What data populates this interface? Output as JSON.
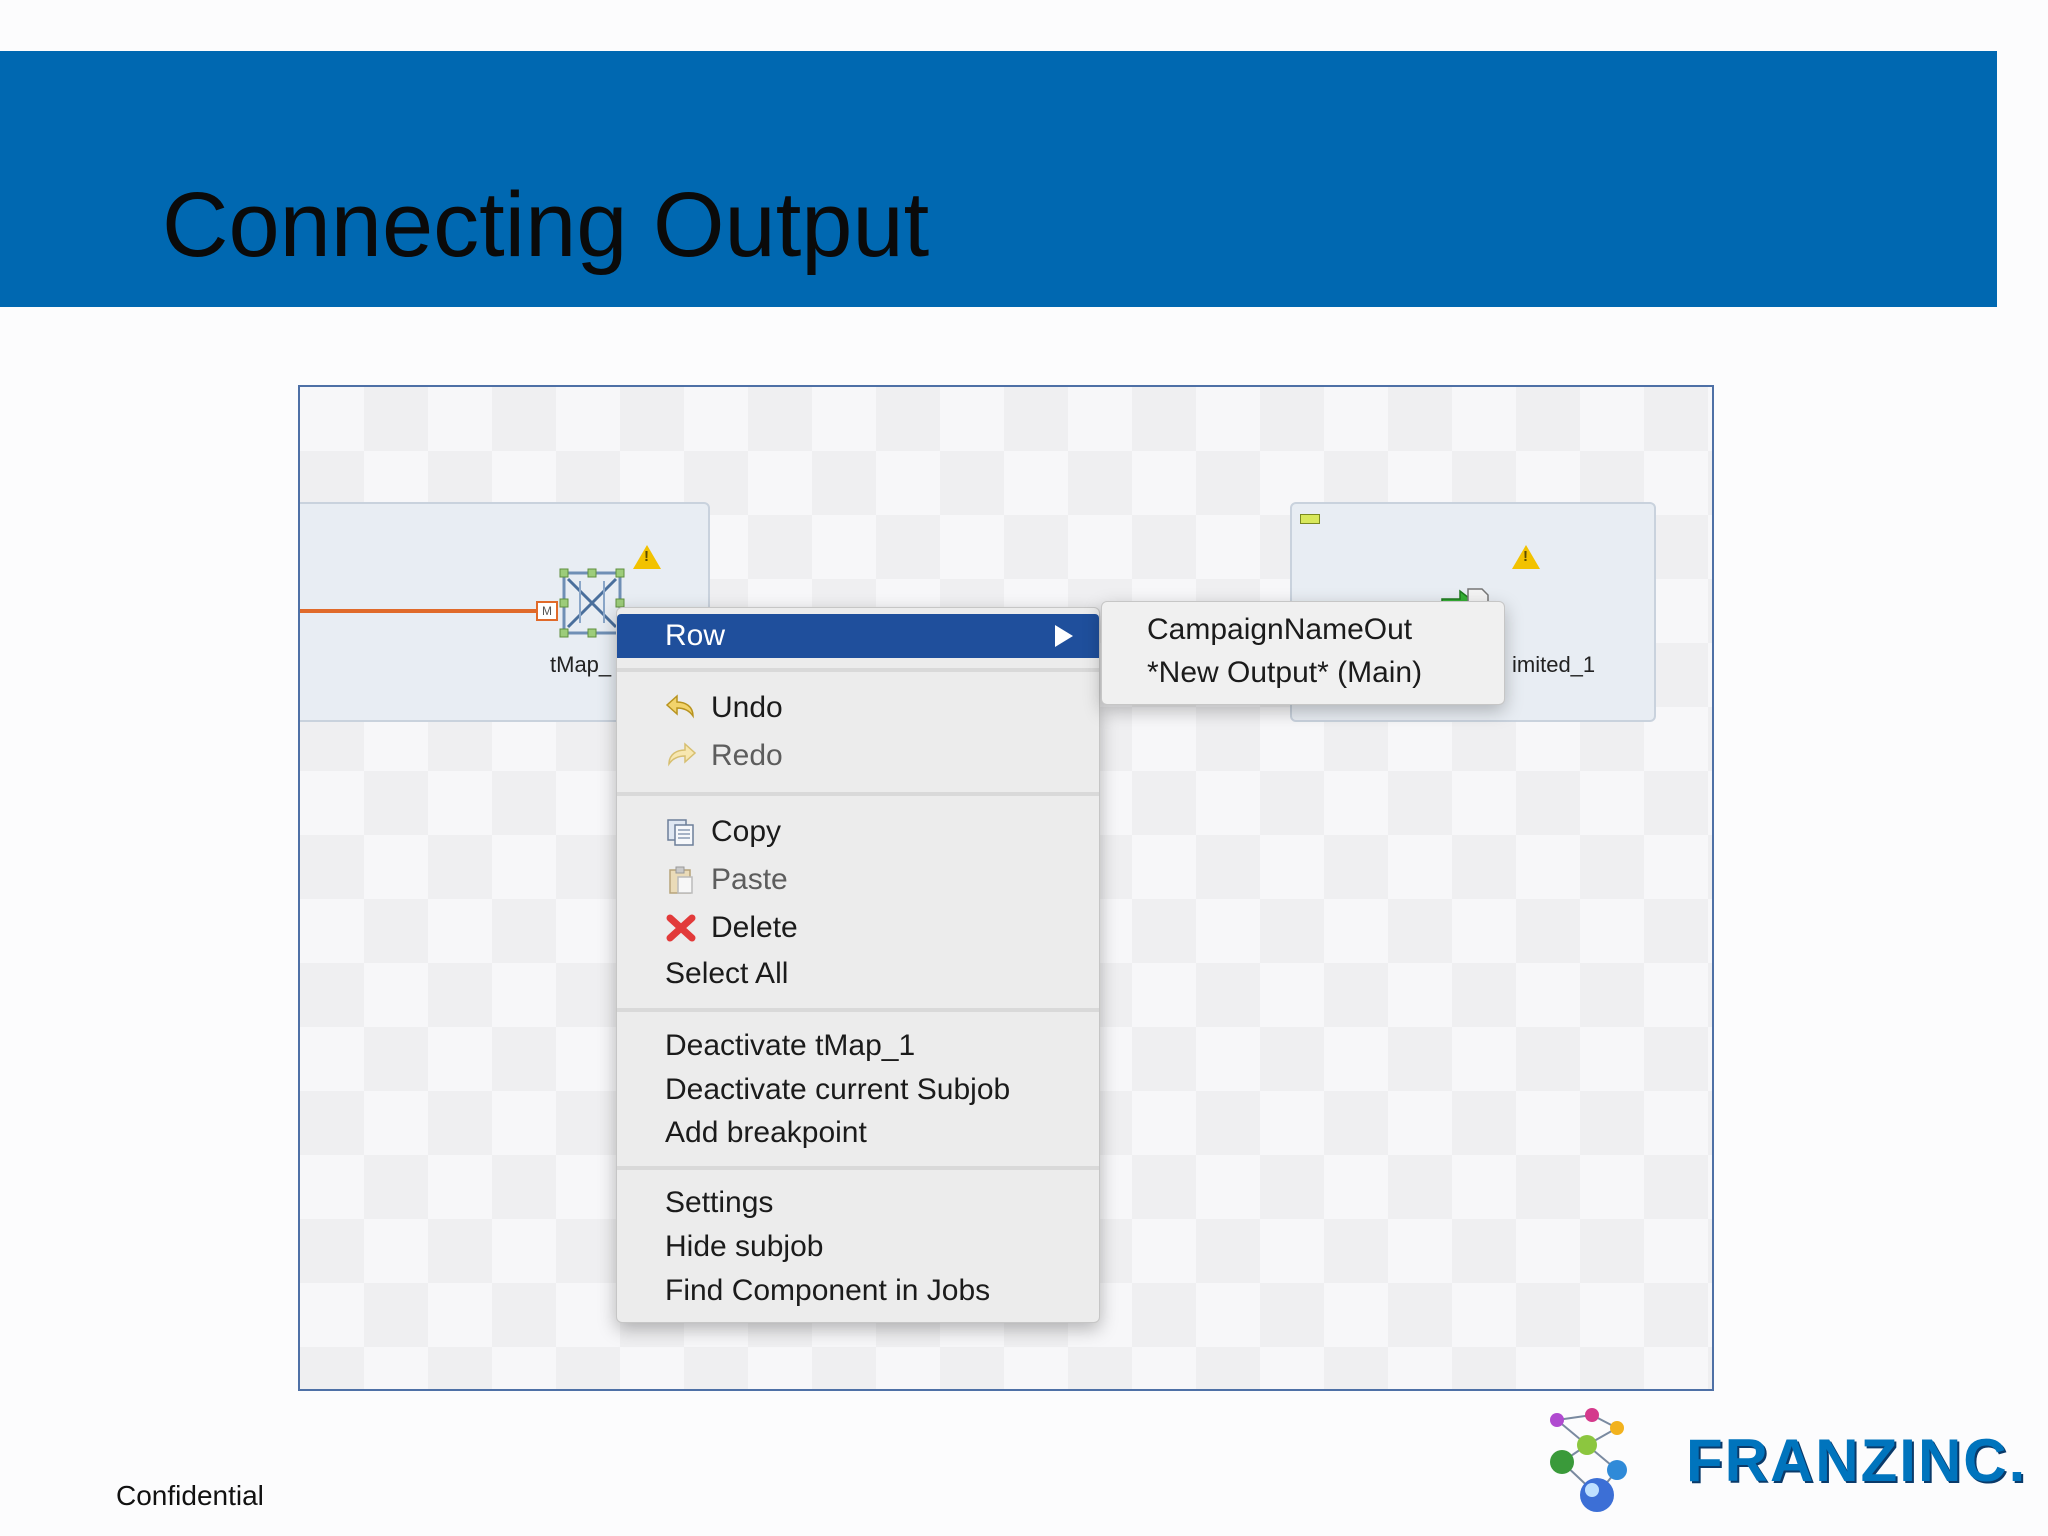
{
  "slide": {
    "title": "Connecting Output",
    "footer": "Confidential",
    "logo_text": "FRANZINC."
  },
  "canvas": {
    "left_component_label": "tMap_",
    "left_component_port": "M",
    "right_component_label": "imited_1"
  },
  "context_menu": {
    "row_label": "Row",
    "undo_label": "Undo",
    "redo_label": "Redo",
    "copy_label": "Copy",
    "paste_label": "Paste",
    "delete_label": "Delete",
    "select_all_label": "Select All",
    "deactivate_component_label": "Deactivate tMap_1",
    "deactivate_subjob_label": "Deactivate current Subjob",
    "add_breakpoint_label": "Add breakpoint",
    "settings_label": "Settings",
    "hide_subjob_label": "Hide subjob",
    "find_component_label": "Find Component in Jobs"
  },
  "submenu": {
    "items": [
      "CampaignNameOut",
      "*New Output* (Main)"
    ]
  },
  "colors": {
    "title_band": "#0068b1",
    "menu_highlight": "#1f4f9c",
    "link_line": "#e06a2a",
    "logo_blue": "#0074bd"
  },
  "icons": [
    "undo-icon",
    "redo-icon",
    "copy-icon",
    "paste-icon",
    "delete-icon",
    "warning-icon",
    "tmap-component-icon",
    "file-output-icon",
    "submenu-arrow-icon",
    "franz-logo-icon"
  ]
}
